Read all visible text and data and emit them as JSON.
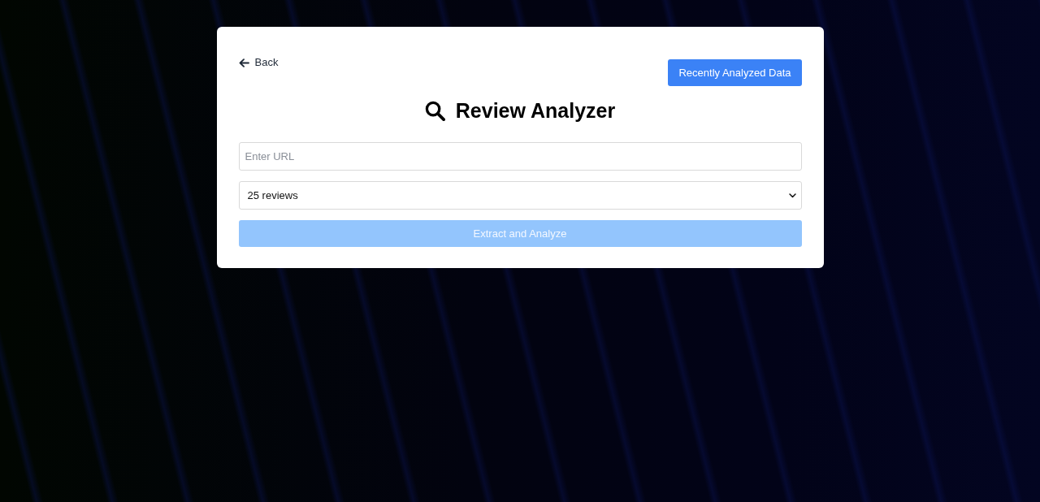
{
  "back_link": {
    "label": "Back"
  },
  "recent_button": {
    "label": "Recently Analyzed Data"
  },
  "title": "Review Analyzer",
  "url_field": {
    "placeholder": "Enter URL"
  },
  "review_count_select": {
    "value": "25 reviews"
  },
  "submit_button": {
    "label": "Extract and Analyze",
    "disabled": true
  }
}
